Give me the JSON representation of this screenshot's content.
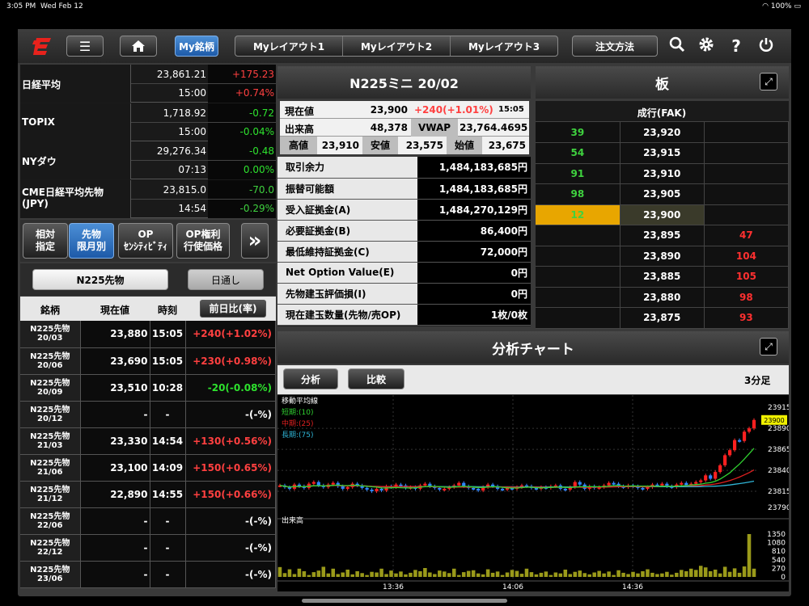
{
  "status": {
    "time": "3:05 PM",
    "date": "Wed Feb 12",
    "battery": "100%",
    "icons": [
      "wifi-icon",
      "battery-icon"
    ]
  },
  "toolbar": {
    "tab_my": "My銘柄",
    "layouts": [
      "Myレイアウト1",
      "Myレイアウト2",
      "Myレイアウト3"
    ],
    "order": "注文方法",
    "icons": [
      "logo-icon",
      "menu-icon",
      "home-icon",
      "search-icon",
      "gear-icon",
      "help-icon",
      "power-icon"
    ],
    "help_glyph": "?"
  },
  "indices": [
    {
      "name": "日経平均",
      "value": "23,861.21",
      "time": "15:00",
      "change": "+175.23",
      "pct": "+0.74%",
      "dir": "up"
    },
    {
      "name": "TOPIX",
      "value": "1,718.92",
      "time": "15:00",
      "change": "-0.72",
      "pct": "-0.04%",
      "dir": "dn"
    },
    {
      "name": "NYダウ",
      "value": "29,276.34",
      "time": "07:13",
      "change": "-0.48",
      "pct": "0.00%",
      "dir": "dn"
    },
    {
      "name": "CME日経平均先物\n(JPY)",
      "value": "23,815.0",
      "time": "14:54",
      "change": "-70.0",
      "pct": "-0.29%",
      "dir": "dn"
    }
  ],
  "filters": {
    "items": [
      "相対\n指定",
      "先物\n限月別",
      "OP\nｾﾝｼﾃｨﾋﾞﾃｨ",
      "OP権利\n行使価格"
    ],
    "active": 1,
    "more": "»"
  },
  "futures": {
    "tab": "N225先物",
    "session": "日通し",
    "headers": [
      "銘柄",
      "現在値",
      "時刻",
      "前日比(率)"
    ],
    "rows": [
      {
        "name": "N225先物\n20/03",
        "price": "23,880",
        "time": "15:05",
        "change": "+240(+1.02%)",
        "dir": "up"
      },
      {
        "name": "N225先物\n20/06",
        "price": "23,690",
        "time": "15:05",
        "change": "+230(+0.98%)",
        "dir": "up"
      },
      {
        "name": "N225先物\n20/09",
        "price": "23,510",
        "time": "10:28",
        "change": "-20(-0.08%)",
        "dir": "dn"
      },
      {
        "name": "N225先物\n20/12",
        "price": "-",
        "time": "-",
        "change": "-(-%)",
        "dir": "none"
      },
      {
        "name": "N225先物\n21/03",
        "price": "23,330",
        "time": "14:54",
        "change": "+130(+0.56%)",
        "dir": "up"
      },
      {
        "name": "N225先物\n21/06",
        "price": "23,100",
        "time": "14:09",
        "change": "+150(+0.65%)",
        "dir": "up"
      },
      {
        "name": "N225先物\n21/12",
        "price": "22,890",
        "time": "14:55",
        "change": "+150(+0.66%)",
        "dir": "up"
      },
      {
        "name": "N225先物\n22/06",
        "price": "-",
        "time": "-",
        "change": "-(-%)",
        "dir": "none"
      },
      {
        "name": "N225先物\n22/12",
        "price": "-",
        "time": "-",
        "change": "-(-%)",
        "dir": "none"
      },
      {
        "name": "N225先物\n23/06",
        "price": "-",
        "time": "-",
        "change": "-(-%)",
        "dir": "none"
      }
    ]
  },
  "quote": {
    "title": "N225ミニ 20/02",
    "cur_label": "現在値",
    "cur": "23,900",
    "cur_chg": "+240(+1.01%)",
    "cur_time": "15:05",
    "vol_label": "出来高",
    "vol": "48,378",
    "vwap_label": "VWAP",
    "vwap": "23,764.4695",
    "high_label": "高値",
    "high": "23,910",
    "low_label": "安値",
    "low": "23,575",
    "open_label": "始値",
    "open": "23,675"
  },
  "margin": [
    {
      "k": "取引余力",
      "v": "1,484,183,685円"
    },
    {
      "k": "振替可能額",
      "v": "1,484,183,685円"
    },
    {
      "k": "受入証拠金(A)",
      "v": "1,484,270,129円"
    },
    {
      "k": "必要証拠金(B)",
      "v": "86,400円"
    },
    {
      "k": "最低維持証拠金(C)",
      "v": "72,000円"
    },
    {
      "k": "Net Option Value(E)",
      "v": "0円"
    },
    {
      "k": "先物建玉評価損(I)",
      "v": "0円"
    },
    {
      "k": "現在建玉数量(先物/売OP)",
      "v": "1枚/0枚"
    }
  ],
  "board": {
    "title": "板",
    "header": "成行(FAK)",
    "rows": [
      {
        "sell": "39",
        "price": "23,920",
        "buy": ""
      },
      {
        "sell": "54",
        "price": "23,915",
        "buy": ""
      },
      {
        "sell": "91",
        "price": "23,910",
        "buy": ""
      },
      {
        "sell": "98",
        "price": "23,905",
        "buy": ""
      },
      {
        "sell": "12",
        "price": "23,900",
        "buy": "",
        "hl": true
      },
      {
        "sell": "",
        "price": "23,895",
        "buy": "47"
      },
      {
        "sell": "",
        "price": "23,890",
        "buy": "104"
      },
      {
        "sell": "",
        "price": "23,885",
        "buy": "105"
      },
      {
        "sell": "",
        "price": "23,880",
        "buy": "98"
      },
      {
        "sell": "",
        "price": "23,875",
        "buy": "93"
      }
    ]
  },
  "chart": {
    "title": "分析チャート",
    "btn_analysis": "分析",
    "btn_compare": "比較",
    "period": "3分足",
    "ma_title": "移動平均線",
    "ma_short": "短期:(10)",
    "ma_mid": "中期:(25)",
    "ma_long": "長期:(75)",
    "vol_title": "出来高",
    "cur_tag": "23900",
    "price_ticks": [
      "23915",
      "23890",
      "23865",
      "23840",
      "23815",
      "23790"
    ],
    "vol_ticks": [
      "1350",
      "1080",
      "810",
      "540",
      "270",
      "0"
    ],
    "time_ticks": [
      "13:36",
      "14:06",
      "14:36"
    ]
  },
  "chart_data": {
    "type": "candlestick",
    "ylim": [
      23790,
      23920
    ],
    "closes": [
      23822,
      23820,
      23818,
      23823,
      23821,
      23819,
      23824,
      23826,
      23822,
      23820,
      23823,
      23825,
      23821,
      23818,
      23820,
      23824,
      23822,
      23819,
      23817,
      23815,
      23818,
      23816,
      23821,
      23820,
      23823,
      23822,
      23819,
      23820,
      23818,
      23822,
      23824,
      23821,
      23819,
      23817,
      23818,
      23820,
      23822,
      23825,
      23821,
      23819,
      23818,
      23816,
      23820,
      23823,
      23821,
      23818,
      23817,
      23819,
      23818,
      23820,
      23822,
      23821,
      23819,
      23818,
      23820,
      23819,
      23821,
      23822,
      23818,
      23817,
      23820,
      23826,
      23823,
      23818,
      23821,
      23819,
      23820,
      23822,
      23825,
      23824,
      23821,
      23820,
      23822,
      23821,
      23819,
      23818,
      23820,
      23823,
      23822,
      23824,
      23821,
      23820,
      23823,
      23825,
      23822,
      23824,
      23826,
      23828,
      23834,
      23830,
      23838,
      23846,
      23858,
      23864,
      23876,
      23875,
      23886,
      23890,
      23900
    ],
    "volumes": [
      310,
      120,
      240,
      90,
      260,
      180,
      60,
      150,
      200,
      320,
      110,
      260,
      90,
      140,
      230,
      80,
      180,
      120,
      60,
      160,
      140,
      260,
      90,
      200,
      110,
      170,
      80,
      130,
      220,
      180,
      280,
      140,
      90,
      200,
      170,
      120,
      260,
      60,
      150,
      190,
      210,
      110,
      80,
      240,
      130,
      170,
      60,
      140,
      220,
      190,
      100,
      260,
      150,
      80,
      130,
      170,
      60,
      140,
      110,
      230,
      90,
      160,
      200,
      120,
      80,
      140,
      190,
      110,
      170,
      60,
      210,
      130,
      90,
      160,
      110,
      180,
      240,
      130,
      90,
      110,
      160,
      70,
      130,
      220,
      180,
      260,
      220,
      350,
      300,
      180,
      230,
      110,
      320,
      160,
      270,
      130,
      330,
      1350,
      260
    ]
  }
}
